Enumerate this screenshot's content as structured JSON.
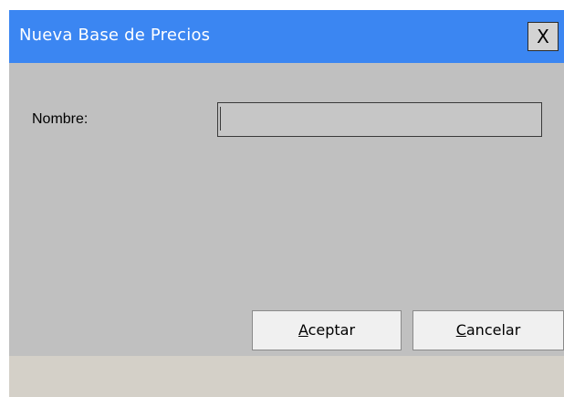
{
  "window": {
    "title": "Nueva Base de Precios",
    "close_label": "X"
  },
  "form": {
    "name_label": "Nombre:",
    "name_value": ""
  },
  "buttons": {
    "accept_mnemonic": "A",
    "accept_rest": "ceptar",
    "cancel_mnemonic": "C",
    "cancel_rest": "ancelar"
  },
  "colors": {
    "titlebar": "#3b86f2",
    "dialog_bg": "#c0c0c0",
    "footer_bg": "#d4d0c8"
  },
  "icons": {
    "close": "close-icon"
  }
}
